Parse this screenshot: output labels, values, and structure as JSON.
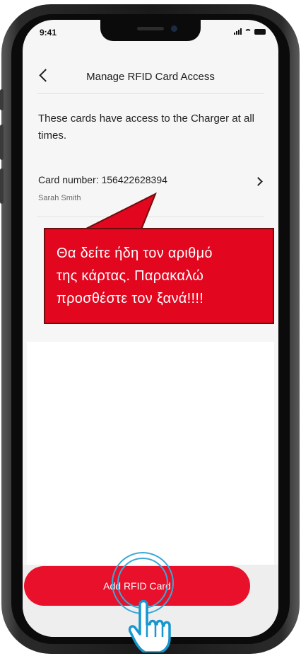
{
  "status_bar": {
    "time": "9:41"
  },
  "header": {
    "title": "Manage RFID Card Access"
  },
  "description": "These cards have access to the Charger at all times.",
  "card": {
    "number_label": "Card number: 156422628394",
    "owner": "Sarah Smith"
  },
  "callout": {
    "lines": [
      "Θα δείτε ήδη τον αριθμό",
      "της κάρτας. Παρακαλώ",
      "προσθέστε τον ξανά!!!!"
    ],
    "color": "#e2061f"
  },
  "add_button": {
    "label": "Add RFID Card",
    "color": "#e8102a"
  },
  "icons": [
    "back-chevron-icon",
    "chevron-right-icon",
    "signal-icon",
    "wifi-icon",
    "battery-icon",
    "pointing-hand-icon"
  ]
}
